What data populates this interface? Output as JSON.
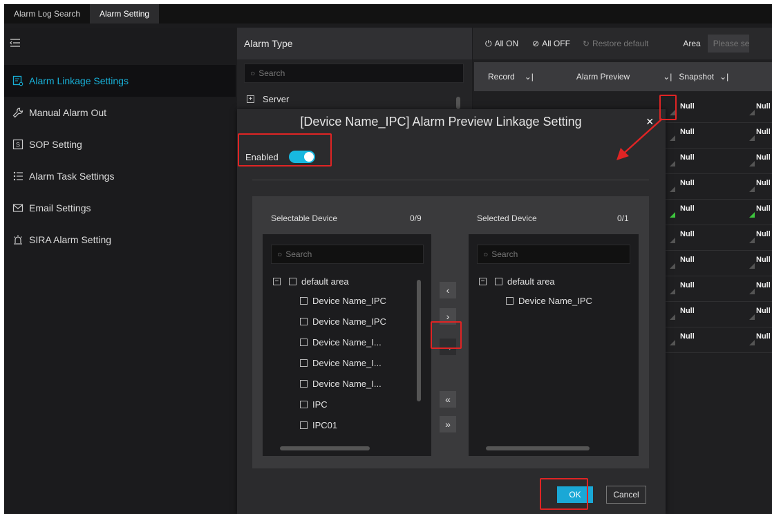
{
  "tabs": [
    {
      "label": "Alarm Log Search"
    },
    {
      "label": "Alarm Setting"
    }
  ],
  "sidebar": {
    "items": [
      {
        "label": "Alarm Linkage Settings",
        "icon": "linkage-icon",
        "active": true
      },
      {
        "label": "Manual Alarm Out",
        "icon": "wrench-icon"
      },
      {
        "label": "SOP Setting",
        "icon": "sop-icon"
      },
      {
        "label": "Alarm Task Settings",
        "icon": "task-list-icon"
      },
      {
        "label": "Email Settings",
        "icon": "mail-icon"
      },
      {
        "label": "SIRA Alarm Setting",
        "icon": "siren-icon"
      }
    ]
  },
  "alarm_type": {
    "title": "Alarm Type",
    "search_placeholder": "Search",
    "server_label": "Server"
  },
  "toolbar": {
    "all_on": "All ON",
    "all_off": "All OFF",
    "restore": "Restore default",
    "area": "Area",
    "area_placeholder": "Please se"
  },
  "columns": {
    "record": "Record",
    "preview": "Alarm Preview",
    "snapshot": "Snapshot"
  },
  "null_text": "Null",
  "modal": {
    "title": "[Device Name_IPC] Alarm Preview Linkage Setting",
    "close": "×",
    "enabled_label": "Enabled",
    "selectable_title": "Selectable Device",
    "selectable_count": "0/9",
    "selected_title": "Selected Device",
    "selected_count": "0/1",
    "search_placeholder": "Search",
    "area_label": "default area",
    "selectable_items": [
      "Device Name_IPC",
      "Device Name_IPC",
      "Device Name_I...",
      "Device Name_I...",
      "Device Name_I...",
      "IPC",
      "IPC01"
    ],
    "selected_items": [
      "Device Name_IPC"
    ],
    "ok": "OK",
    "cancel": "Cancel"
  },
  "colors": {
    "accent": "#18b1d8",
    "highlight": "#e02424"
  }
}
